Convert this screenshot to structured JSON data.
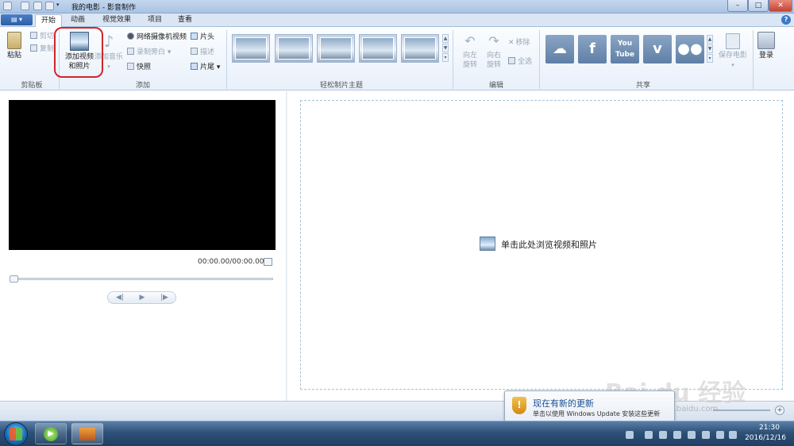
{
  "window": {
    "title": "我的电影 - 影音制作"
  },
  "tabs": [
    {
      "label": "开始",
      "active": true
    },
    {
      "label": "动画"
    },
    {
      "label": "视觉效果"
    },
    {
      "label": "项目"
    },
    {
      "label": "查看"
    }
  ],
  "ribbon": {
    "clipboard": {
      "paste": "粘贴",
      "cut": "剪切",
      "copy": "复制",
      "group": "剪贴板"
    },
    "add": {
      "add_video_line1": "添加视频",
      "add_video_line2": "和照片",
      "add_music": "添加音乐",
      "webcam": "网络摄像机视频",
      "narration": "录制旁白",
      "snapshot": "快照",
      "title": "片头",
      "caption": "描述",
      "credits": "片尾",
      "group": "添加"
    },
    "themes": {
      "group": "轻松制片主题"
    },
    "editing": {
      "rotate_left_1": "向左",
      "rotate_left_2": "旋转",
      "rotate_right_1": "向右",
      "rotate_right_2": "旋转",
      "remove": "移除",
      "select_all": "全选",
      "group": "编辑"
    },
    "share": {
      "youtube": "You Tube",
      "save_movie": "保存电影",
      "group": "共享"
    },
    "signin": "登录"
  },
  "player": {
    "timecode": "00:00.00/00:00.00"
  },
  "storyboard": {
    "hint": "单击此处浏览视频和照片"
  },
  "notification": {
    "title": "现在有新的更新",
    "subtitle": "单击以使用 Windows Update 安装这些更新"
  },
  "tray": {
    "time": "21:30",
    "date": "2016/12/16"
  },
  "watermark": {
    "main": "Bai du 经验",
    "sub": "jingyan.baidu.com"
  },
  "colors": {
    "highlight": "#d0252c",
    "accent": "#3b79c9"
  }
}
